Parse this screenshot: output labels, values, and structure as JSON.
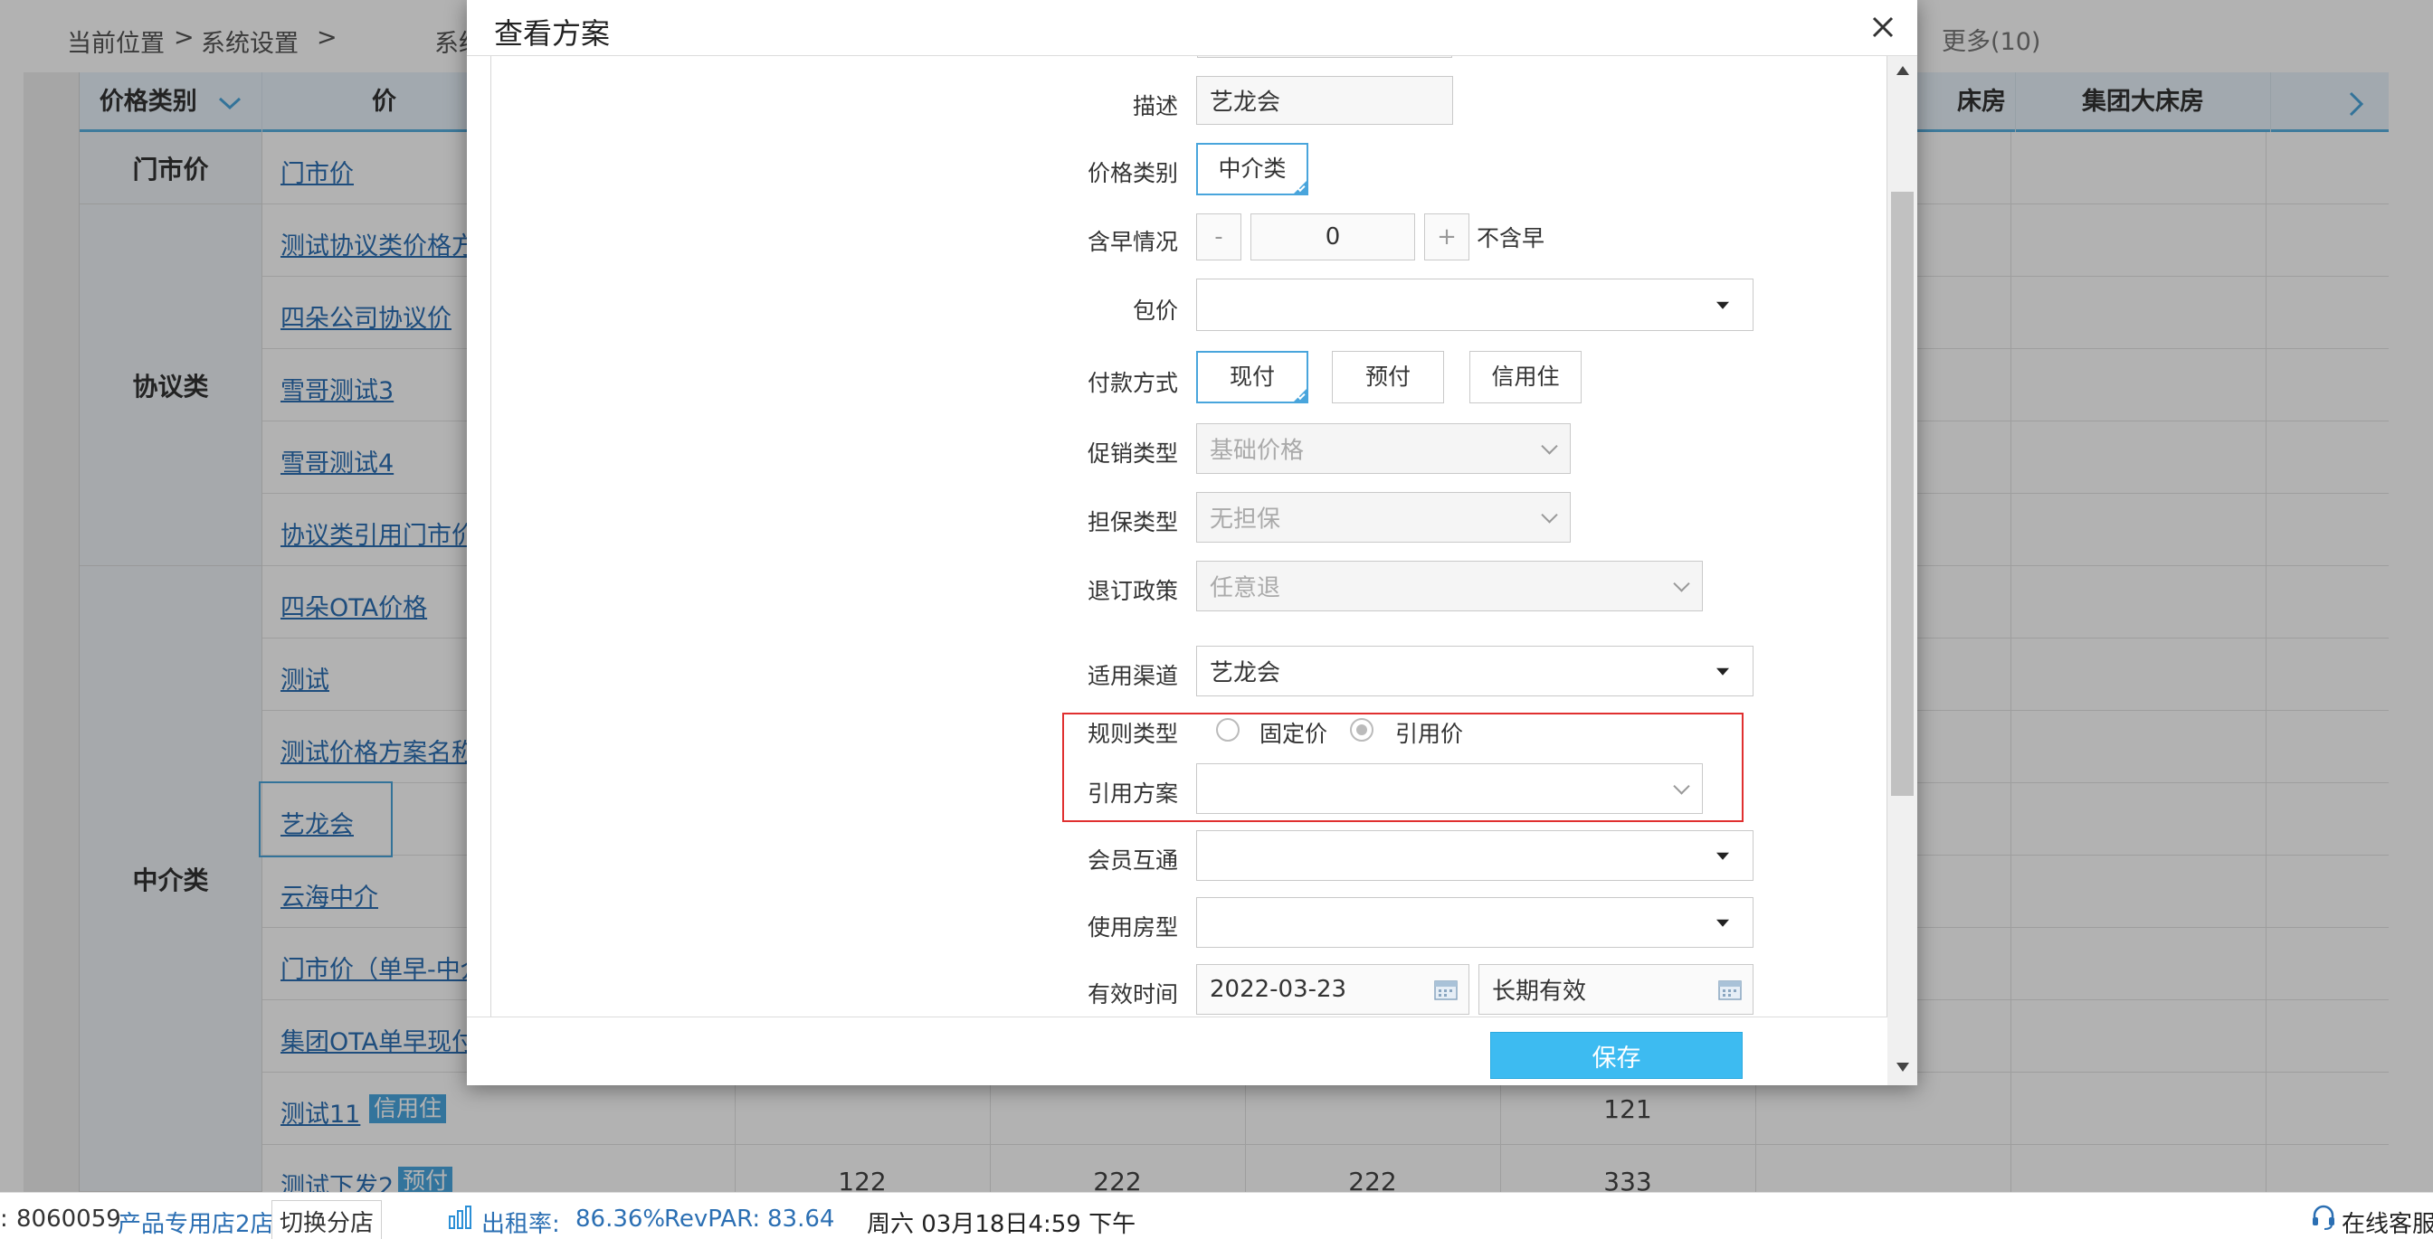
{
  "breadcrumb": {
    "current_position": "当前位置",
    "sep1": ">",
    "system_settings": "系统设置",
    "sep2": ">",
    "partial": "系统",
    "more": "更多(10)"
  },
  "table": {
    "headers": {
      "price_category": "价格类别",
      "price_name_partial": "价",
      "room_partial": "床房",
      "group_big_bed": "集团大床房",
      "next_partial": "‹"
    },
    "groups": [
      {
        "name": "门市价"
      },
      {
        "name": "协议类"
      },
      {
        "name": "中介类"
      }
    ],
    "rows": [
      {
        "name": "门市价",
        "tag": ""
      },
      {
        "name": "测试协议类价格方",
        "tag": ""
      },
      {
        "name": "四朵公司协议价",
        "tag": ""
      },
      {
        "name": "雪哥测试3",
        "tag": ""
      },
      {
        "name": "雪哥测试4",
        "tag": ""
      },
      {
        "name": "协议类引用门市价",
        "tag": ""
      },
      {
        "name": "四朵OTA价格",
        "tag": ""
      },
      {
        "name": "测试",
        "tag": ""
      },
      {
        "name": "测试价格方案名称",
        "tag": ""
      },
      {
        "name": "艺龙会",
        "tag": ""
      },
      {
        "name": "云海中介",
        "tag": ""
      },
      {
        "name": "门市价（单早-中介",
        "tag": ""
      },
      {
        "name": "集团OTA单早现付",
        "tag": ""
      },
      {
        "name": "测试11",
        "tag": "信用住"
      },
      {
        "name": "测试下发2",
        "tag": "预付"
      }
    ],
    "row_values": {
      "test11": [
        "121"
      ],
      "test2": [
        "122",
        "222",
        "222",
        "333"
      ]
    }
  },
  "status_bar": {
    "id_prefix": ":",
    "store_code": "8060059",
    "store_name": "产品专用店2店",
    "switch_store": "切换分店",
    "occupancy_label": "出租率:",
    "occupancy_value": "86.36%",
    "revpar_label": "RevPAR:",
    "revpar_value": "83.64",
    "datetime": "周六 03月18日4:59 下午",
    "online_service": "在线客服"
  },
  "modal": {
    "title": "查看方案",
    "close_icon": "close-icon",
    "fields": {
      "description": {
        "label": "描述",
        "value": "艺龙会"
      },
      "price_category": {
        "label": "价格类别",
        "value": "中介类"
      },
      "breakfast": {
        "label": "含早情况",
        "minus": "-",
        "value": "0",
        "plus": "+",
        "text": "不含早"
      },
      "package": {
        "label": "包价",
        "value": ""
      },
      "payment": {
        "label": "付款方式",
        "options": [
          "现付",
          "预付",
          "信用住"
        ],
        "selected": "现付"
      },
      "promo_type": {
        "label": "促销类型",
        "value": "基础价格"
      },
      "guarantee_type": {
        "label": "担保类型",
        "value": "无担保"
      },
      "cancel_policy": {
        "label": "退订政策",
        "value": "任意退"
      },
      "channel": {
        "label": "适用渠道",
        "value": "艺龙会"
      },
      "rule_type": {
        "label": "规则类型",
        "options": [
          "固定价",
          "引用价"
        ],
        "selected": "引用价"
      },
      "ref_plan": {
        "label": "引用方案",
        "value": ""
      },
      "member_share": {
        "label": "会员互通",
        "value": ""
      },
      "room_type": {
        "label": "使用房型",
        "value": ""
      },
      "valid_time": {
        "label": "有效时间",
        "start": "2022-03-23",
        "end": "长期有效"
      }
    },
    "save_label": "保存"
  },
  "colors": {
    "accent": "#3dbbf1",
    "link": "#2b6fb3",
    "highlight_border": "#e03030",
    "selected_border": "#49a5dc"
  }
}
